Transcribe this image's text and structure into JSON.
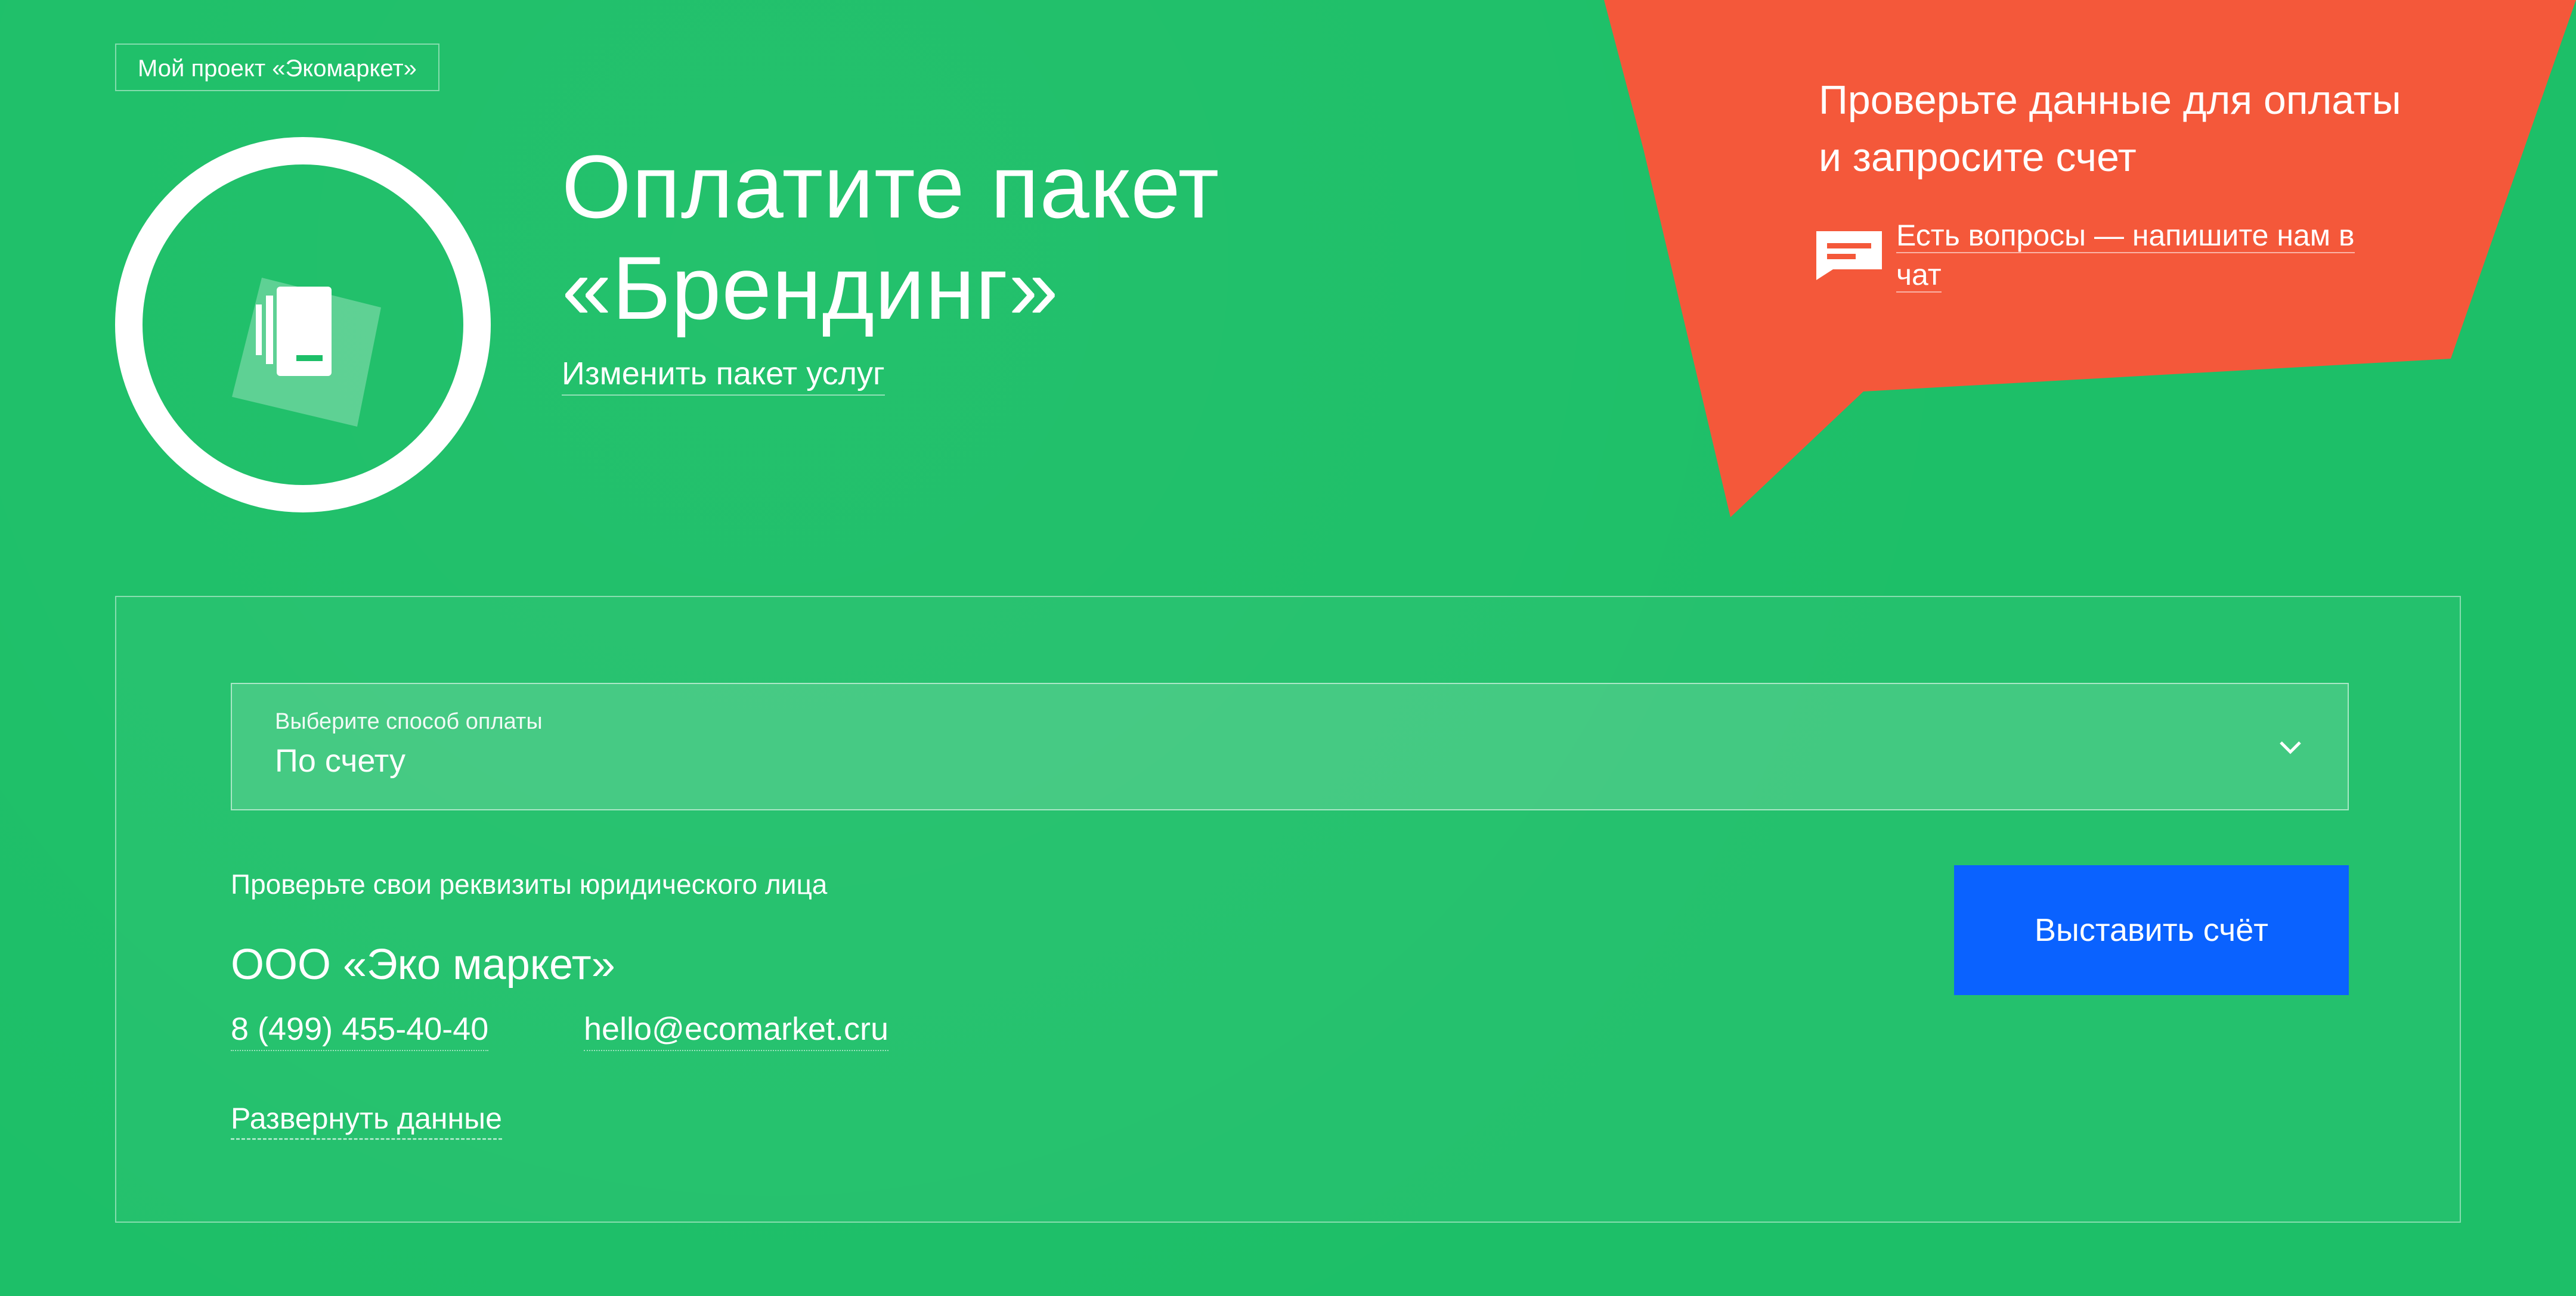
{
  "colors": {
    "background": "#1dbf68",
    "bubble": "#f4583a",
    "button": "#0a62ff",
    "text": "#ffffff"
  },
  "header": {
    "project_chip": "Мой проект «Экомаркет»",
    "title_line1": "Оплатите пакет",
    "title_line2": "«Брендинг»",
    "change_link": "Изменить пакет услуг",
    "logo_icon": "documents-icon"
  },
  "bubble": {
    "title": "Проверьте данные для оплаты и запросите счет",
    "chat_icon": "chat-icon",
    "chat_link_underlined": "Есть вопросы",
    "chat_link_rest": " — напишите нам в чат"
  },
  "payment": {
    "select_label": "Выберите способ оплаты",
    "select_value": "По счету",
    "chevron_icon": "chevron-down-icon"
  },
  "requisites": {
    "label": "Проверьте свои реквизиты юридического лица",
    "company": "ООО «Эко маркет»",
    "phone": "8 (499) 455-40-40",
    "email": "hello@ecomarket.cru",
    "expand_link": "Развернуть данные"
  },
  "actions": {
    "invoice_button": "Выставить счёт"
  }
}
